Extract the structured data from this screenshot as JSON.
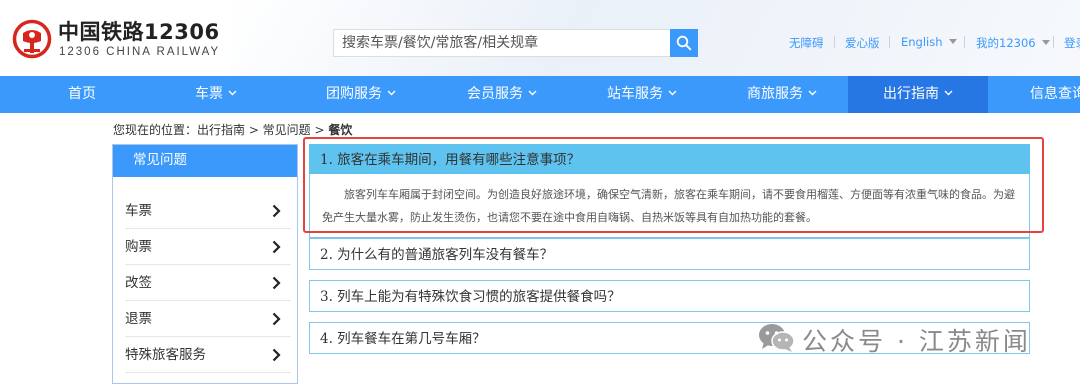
{
  "header": {
    "logo_cn": "中国铁路12306",
    "logo_en": "12306 CHINA RAILWAY",
    "search_placeholder": "搜索车票/餐饮/常旅客/相关规章",
    "links": [
      "无障碍",
      "爱心版",
      "English",
      "我的12306",
      "登录"
    ]
  },
  "nav": {
    "items": [
      {
        "label": "首页",
        "has_caret": false,
        "active": false
      },
      {
        "label": "车票",
        "has_caret": true,
        "active": false
      },
      {
        "label": "团购服务",
        "has_caret": true,
        "active": false
      },
      {
        "label": "会员服务",
        "has_caret": true,
        "active": false
      },
      {
        "label": "站车服务",
        "has_caret": true,
        "active": false
      },
      {
        "label": "商旅服务",
        "has_caret": true,
        "active": false
      },
      {
        "label": "出行指南",
        "has_caret": true,
        "active": true
      },
      {
        "label": "信息查询",
        "has_caret": true,
        "active": false
      }
    ]
  },
  "breadcrumb": {
    "prefix": "您现在的位置：出行指南 > 常见问题 > ",
    "current": "餐饮"
  },
  "sidebar": {
    "title": "常见问题",
    "items": [
      "车票",
      "购票",
      "改签",
      "退票",
      "特殊旅客服务"
    ]
  },
  "faq": [
    {
      "question": "1. 旅客在乘车期间，用餐有哪些注意事项？",
      "answer": "旅客列车车厢属于封闭空间。为创造良好旅途环境，确保空气清新，旅客在乘车期间，请不要食用榴莲、方便面等有浓重气味的食品。为避免产生大量水雾，防止发生烫伤，也请您不要在途中食用自嗨锅、自热米饭等具有自加热功能的套餐。",
      "open": true
    },
    {
      "question": "2. 为什么有的普通旅客列车没有餐车？",
      "open": false
    },
    {
      "question": "3. 列车上能为有特殊饮食习惯的旅客提供餐食吗？",
      "open": false
    },
    {
      "question": "4. 列车餐车在第几号车厢？",
      "open": false
    }
  ],
  "watermark": {
    "text": "公众号 · 江苏新闻"
  },
  "colors": {
    "nav_blue": "#3b99fc",
    "nav_active": "#2676e3",
    "faq_open_bg": "#5ec4ef",
    "highlight_red": "#e64340",
    "logo_red": "#d7261c"
  }
}
